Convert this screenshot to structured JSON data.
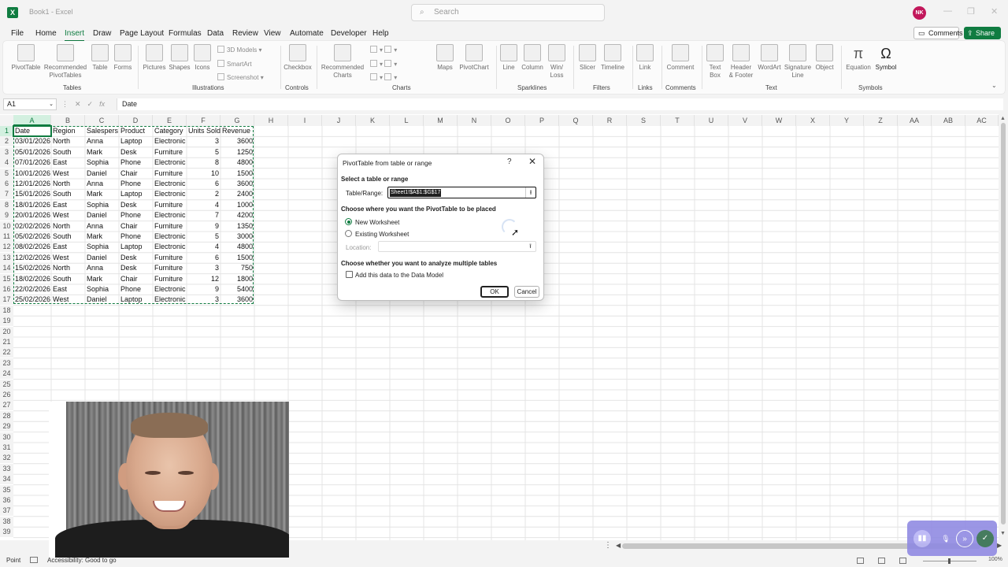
{
  "window": {
    "doc_title": "Book1 - Excel",
    "search_placeholder": "Search",
    "user_initials": "NK",
    "logo_letter": "X"
  },
  "menu": {
    "tabs": [
      "File",
      "Home",
      "Insert",
      "Draw",
      "Page Layout",
      "Formulas",
      "Data",
      "Review",
      "View",
      "Automate",
      "Developer",
      "Help"
    ],
    "active_tab": "Insert",
    "comments_label": "Comments",
    "share_label": "Share"
  },
  "ribbon": {
    "tables": {
      "pivottable": "PivotTable",
      "recommended_1": "Recommended",
      "recommended_2": "PivotTables",
      "table": "Table",
      "forms": "Forms",
      "group": "Tables"
    },
    "illustrations": {
      "pictures": "Pictures",
      "shapes": "Shapes",
      "icons": "Icons",
      "models": "3D Models",
      "smartart": "SmartArt",
      "screenshot": "Screenshot",
      "group": "Illustrations"
    },
    "controls": {
      "checkbox": "Checkbox",
      "group": "Controls"
    },
    "charts": {
      "recommended_1": "Recommended",
      "recommended_2": "Charts",
      "maps": "Maps",
      "pivotchart": "PivotChart",
      "group": "Charts"
    },
    "sparklines": {
      "line": "Line",
      "column": "Column",
      "winloss_1": "Win/",
      "winloss_2": "Loss",
      "group": "Sparklines"
    },
    "filters": {
      "slicer": "Slicer",
      "timeline": "Timeline",
      "group": "Filters"
    },
    "links": {
      "link": "Link",
      "group": "Links"
    },
    "comments": {
      "comment": "Comment",
      "group": "Comments"
    },
    "text": {
      "textbox_1": "Text",
      "textbox_2": "Box",
      "header_1": "Header",
      "header_2": "& Footer",
      "wordart": "WordArt",
      "signature_1": "Signature",
      "signature_2": "Line",
      "object": "Object",
      "group": "Text"
    },
    "symbols": {
      "equation": "Equation",
      "symbol": "Symbol",
      "group": "Symbols"
    }
  },
  "formula_bar": {
    "name_box": "A1",
    "formula": "Date"
  },
  "sheet": {
    "columns": [
      "A",
      "B",
      "C",
      "D",
      "E",
      "F",
      "G",
      "H",
      "I",
      "J",
      "K",
      "L",
      "M",
      "N",
      "O",
      "P",
      "Q",
      "R",
      "S",
      "T",
      "U",
      "V",
      "W",
      "X",
      "Y",
      "Z",
      "AA",
      "AB",
      "AC"
    ],
    "row_count": 39,
    "headers": [
      "Date",
      "Region",
      "Salespers",
      "Product",
      "Category",
      "Units Sold",
      "Revenue"
    ],
    "rows": [
      [
        "03/01/2026",
        "North",
        "Anna",
        "Laptop",
        "Electronic",
        "3",
        "3600"
      ],
      [
        "05/01/2026",
        "South",
        "Mark",
        "Desk",
        "Furniture",
        "5",
        "1250"
      ],
      [
        "07/01/2026",
        "East",
        "Sophia",
        "Phone",
        "Electronic",
        "8",
        "4800"
      ],
      [
        "10/01/2026",
        "West",
        "Daniel",
        "Chair",
        "Furniture",
        "10",
        "1500"
      ],
      [
        "12/01/2026",
        "North",
        "Anna",
        "Phone",
        "Electronic",
        "6",
        "3600"
      ],
      [
        "15/01/2026",
        "South",
        "Mark",
        "Laptop",
        "Electronic",
        "2",
        "2400"
      ],
      [
        "18/01/2026",
        "East",
        "Sophia",
        "Desk",
        "Furniture",
        "4",
        "1000"
      ],
      [
        "20/01/2026",
        "West",
        "Daniel",
        "Phone",
        "Electronic",
        "7",
        "4200"
      ],
      [
        "02/02/2026",
        "North",
        "Anna",
        "Chair",
        "Furniture",
        "9",
        "1350"
      ],
      [
        "05/02/2026",
        "South",
        "Mark",
        "Phone",
        "Electronic",
        "5",
        "3000"
      ],
      [
        "08/02/2026",
        "East",
        "Sophia",
        "Laptop",
        "Electronic",
        "4",
        "4800"
      ],
      [
        "12/02/2026",
        "West",
        "Daniel",
        "Desk",
        "Furniture",
        "6",
        "1500"
      ],
      [
        "15/02/2026",
        "North",
        "Anna",
        "Desk",
        "Furniture",
        "3",
        "750"
      ],
      [
        "18/02/2026",
        "South",
        "Mark",
        "Chair",
        "Furniture",
        "12",
        "1800"
      ],
      [
        "22/02/2026",
        "East",
        "Sophia",
        "Phone",
        "Electronic",
        "9",
        "5400"
      ],
      [
        "25/02/2026",
        "West",
        "Daniel",
        "Laptop",
        "Electronic",
        "3",
        "3600"
      ]
    ]
  },
  "dialog": {
    "title": "PivotTable from table or range",
    "help": "?",
    "close": "✕",
    "select_heading": "Select a table or range",
    "table_range_label": "Table/Range:",
    "table_range_value": "Sheet1!$A$1:$G$17",
    "place_heading": "Choose where you want the PivotTable to be placed",
    "new_worksheet": "New Worksheet",
    "existing_worksheet": "Existing Worksheet",
    "location_label": "Location:",
    "location_value": "",
    "multiple_heading": "Choose whether you want to analyze multiple tables",
    "data_model_label": "Add this data to the Data Model",
    "ok": "OK",
    "cancel": "Cancel",
    "selected_option": "New Worksheet",
    "data_model_checked": false
  },
  "status": {
    "mode": "Point",
    "accessibility": "Accessibility: Good to go",
    "zoom": "100%"
  },
  "colors": {
    "accent": "#107c41",
    "recorder": "#8e88e2"
  }
}
